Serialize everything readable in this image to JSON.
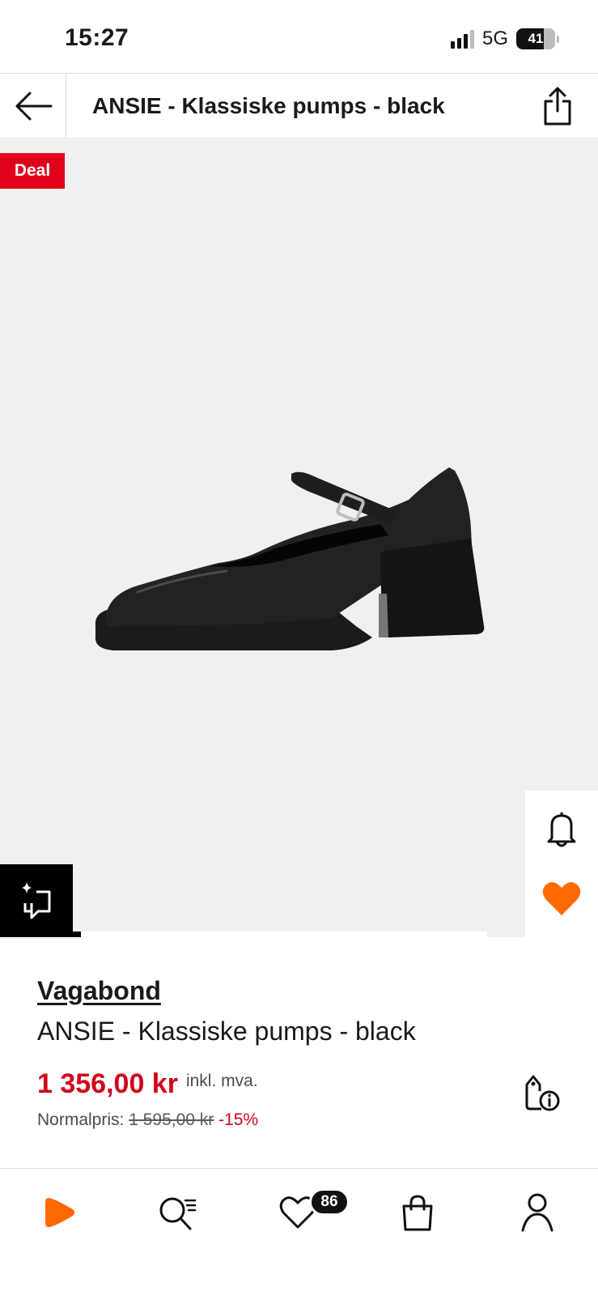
{
  "status_bar": {
    "time": "15:27",
    "network": "5G",
    "battery": "41"
  },
  "header": {
    "title": "ANSIE - Klassiske pumps - black",
    "back_icon": "arrow-left-icon",
    "share_icon": "share-icon"
  },
  "gallery": {
    "deal_label": "Deal",
    "progress": 0.02,
    "notify_icon": "bell-icon",
    "wishlist_icon": "heart-filled-icon",
    "similar_icon": "similar-items-icon"
  },
  "product": {
    "brand": "Vagabond",
    "name": "ANSIE - Klassiske pumps - black",
    "price": "1 356,00 kr",
    "vat_label": "inkl. mva.",
    "normal_label": "Normalpris:",
    "old_price": "1 595,00 kr",
    "discount": "-15%",
    "price_info_icon": "tag-info-icon"
  },
  "bottom_nav": {
    "items": [
      {
        "name": "home",
        "icon": "zalando-play-icon"
      },
      {
        "name": "search",
        "icon": "search-icon"
      },
      {
        "name": "wishlist",
        "icon": "heart-icon",
        "badge": "86"
      },
      {
        "name": "bag",
        "icon": "bag-icon"
      },
      {
        "name": "account",
        "icon": "user-icon"
      }
    ]
  },
  "colors": {
    "accent": "#ff6900",
    "deal": "#e0001b",
    "price": "#d0021b",
    "gallery_bg": "#f0f0f0"
  }
}
